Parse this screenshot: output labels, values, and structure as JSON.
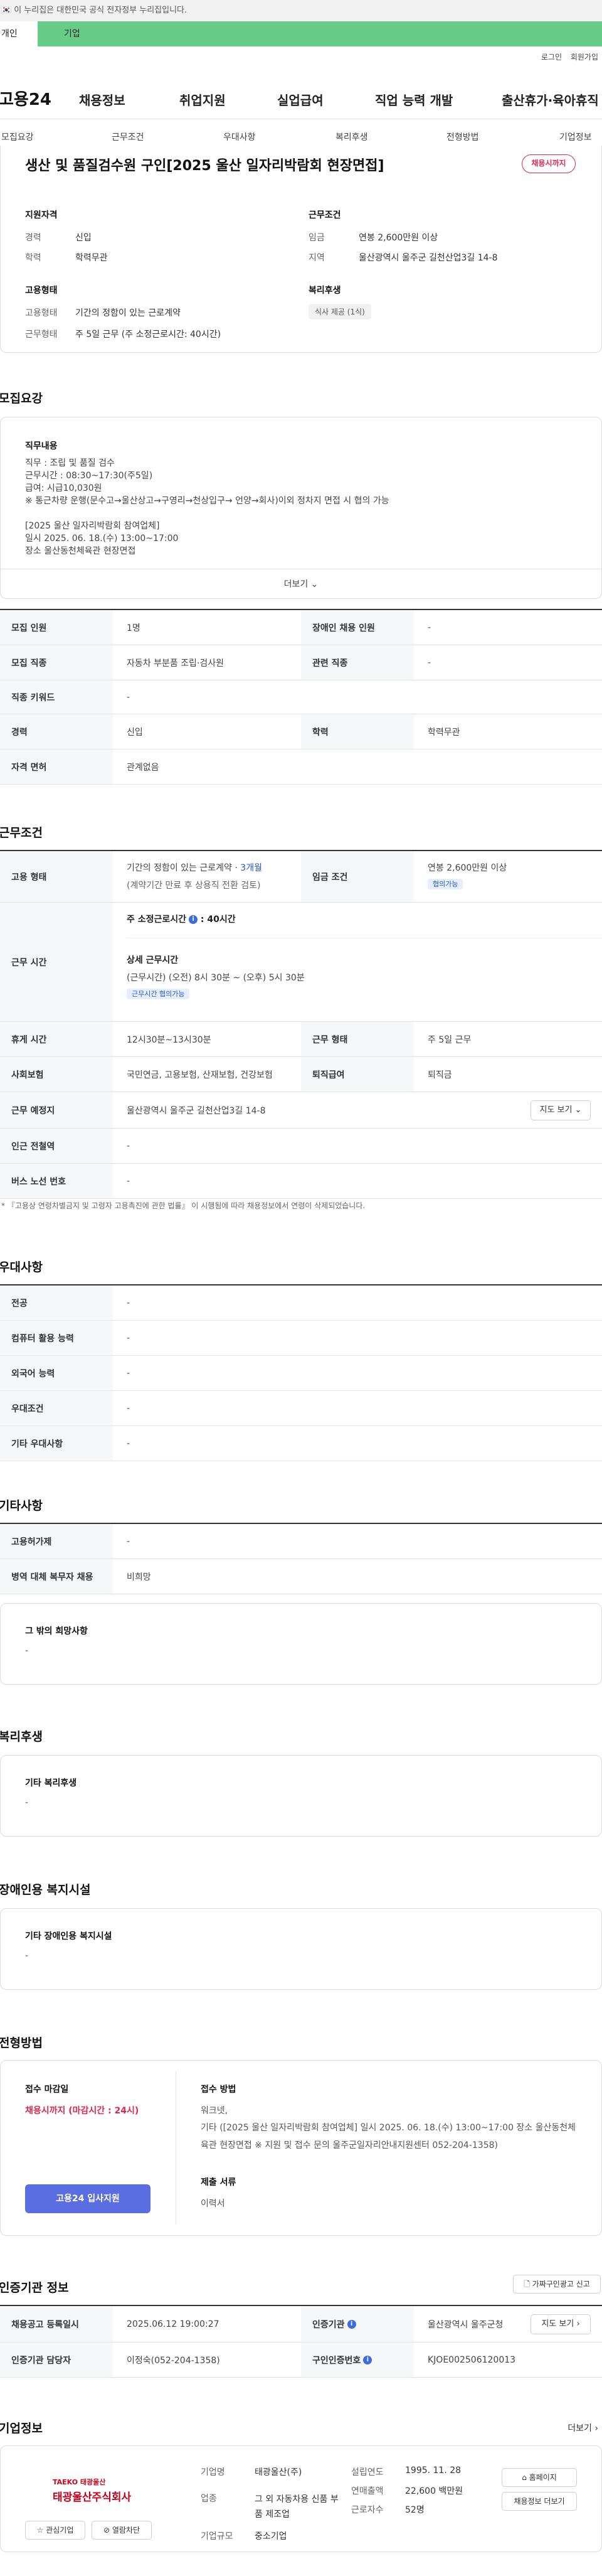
{
  "gov_banner": {
    "flag": "🇰🇷",
    "text": "이 누리집은 대한민국 공식 전자정부 누리집입니다."
  },
  "audience_tabs": {
    "personal": "개인",
    "corporate": "기업"
  },
  "util_links": {
    "login": "로그인",
    "signup": "회원가입"
  },
  "site": {
    "logo": "고용24"
  },
  "gnb": [
    "채용정보",
    "취업지원",
    "실업급여",
    "직업 능력 개발",
    "출산휴가·육아휴직"
  ],
  "subnav": [
    "모집요강",
    "근무조건",
    "우대사항",
    "복리후생",
    "전형방법",
    "기업정보"
  ],
  "job": {
    "title": "생산 및 품질검수원 구인[2025 울산 일자리박람회 현장면접]",
    "deadline_badge": "채용시까지"
  },
  "summary": {
    "qual_title": "지원자격",
    "career_label": "경력",
    "career_value": "신입",
    "edu_label": "학력",
    "edu_value": "학력무관",
    "cond_title": "근무조건",
    "wage_label": "임금",
    "wage_value": "연봉 2,600만원 이상",
    "area_label": "지역",
    "area_value": "울산광역시 울주군 길천산업3길 14-8",
    "emp_title": "고용형태",
    "emp_type_label": "고용형태",
    "emp_type_value": "기간의 정함이 있는 근로계약",
    "work_type_label": "근무형태",
    "work_type_value": "주 5일 근무 (주 소정근로시간: 40시간)",
    "welfare_title": "복리후생",
    "welfare_chip": "식사 제공 (1식)"
  },
  "recruit": {
    "section_title": "모집요강",
    "duty_label": "직무내용",
    "duty_lines": [
      "직무 : 조립 및 품질 검수",
      "근무시간 : 08:30~17:30(주5일)",
      "급여: 시급10,030원",
      "※ 통근차량 운행(문수고→울산상고→구영리→천상입구→ 언양→회사)이외 정차지 면접 시 협의 가능",
      "",
      "[2025 울산 일자리박람회 참여업체]",
      "일시 2025. 06. 18.(수) 13:00~17:00",
      "장소 울산동천체육관 현장면접"
    ],
    "more_label": "더보기",
    "table": [
      {
        "k1": "모집 인원",
        "v1": "1명",
        "k2": "장애인 채용 인원",
        "v2": "-"
      },
      {
        "k1": "모집 직종",
        "v1": "자동차 부분품 조립·검사원",
        "k2": "관련 직종",
        "v2": "-"
      },
      {
        "k1": "직종 키워드",
        "v1": "-"
      },
      {
        "k1": "경력",
        "v1": "신입",
        "k2": "학력",
        "v2": "학력무관"
      },
      {
        "k1": "자격 면허",
        "v1": "관계없음"
      }
    ]
  },
  "conditions": {
    "section_title": "근무조건",
    "emp_label": "고용 형태",
    "emp_value": "기간의 정함이 있는 근로계약",
    "emp_period": "3개월",
    "emp_note": "(계약기간 만료 후 상용직 전환 검토)",
    "wage_label": "임금 조건",
    "wage_value": "연봉 2,600만원 이상",
    "wage_chip": "협의가능",
    "hours_label": "근무 시간",
    "hours_week": "주 소정근로시간",
    "hours_week_value": "40시간",
    "hours_detail_title": "상세 근무시간",
    "hours_detail": "(근무시간) (오전) 8시 30분 ~ (오후) 5시 30분",
    "hours_chip": "근무시간 협의가능",
    "break_label": "휴게 시간",
    "break_value": "12시30분~13시30분",
    "form_label": "근무 형태",
    "form_value": "주 5일 근무",
    "insur_label": "사회보험",
    "insur_value": "국민연금, 고용보험, 산재보험, 건강보험",
    "sever_label": "퇴직급여",
    "sever_value": "퇴직금",
    "place_label": "근무 예정지",
    "place_value": "울산광역시 울주군 길천산업3길 14-8",
    "map_btn": "지도 보기",
    "subway_label": "인근 전철역",
    "subway_value": "-",
    "bus_label": "버스 노선 번호",
    "bus_value": "-",
    "footnote": "* 『고용상 연령차별금지 및 고령자 고용촉진에 관한 법률』 이 시행됨에 따라 채용정보에서 연령이 삭제되었습니다."
  },
  "preference": {
    "section_title": "우대사항",
    "rows": [
      {
        "k": "전공",
        "v": "-"
      },
      {
        "k": "컴퓨터 활용 능력",
        "v": "-"
      },
      {
        "k": "외국어 능력",
        "v": "-"
      },
      {
        "k": "우대조건",
        "v": "-"
      },
      {
        "k": "기타 우대사항",
        "v": "-"
      }
    ]
  },
  "etc": {
    "section_title": "기타사항",
    "rows": [
      {
        "k": "고용허가제",
        "v": "-"
      },
      {
        "k": "병역 대체 복무자 채용",
        "v": "비희망"
      }
    ],
    "box_label": "그 밖의 희망사항",
    "box_value": "-"
  },
  "welfare": {
    "section_title": "복리후생",
    "box_label": "기타 복리후생",
    "box_value": "-"
  },
  "disability": {
    "section_title": "장애인용 복지시설",
    "box_label": "기타 장애인용 복지시설",
    "box_value": "-"
  },
  "selection": {
    "section_title": "전형방법",
    "deadline_label": "접수 마감일",
    "deadline_value": "채용시까지 (마감시간 : 24시)",
    "method_label": "접수 방법",
    "method_value": "워크넷,",
    "method_detail": "기타 ([2025 울산 일자리박람회 참여업체] 일시 2025. 06. 18.(수) 13:00~17:00 장소 울산동천체육관 현장면접 ※ 지원 및 접수 문의 울주군일자리안내지원센터 052-204-1358)",
    "docs_label": "제출 서류",
    "docs_value": "이력서",
    "apply_btn": "고용24 입사지원"
  },
  "cert": {
    "section_title": "인증기관 정보",
    "copy_btn": "가짜구인광고 신고",
    "reg_label": "채용공고 등록일시",
    "reg_value": "2025.06.12 19:00:27",
    "agency_label": "인증기관",
    "agency_value": "울산광역시 울주군청",
    "map_btn": "지도 보기",
    "manager_label": "인증기관 담당자",
    "manager_value": "이정숙(052-204-1358)",
    "id_label": "구인인증번호",
    "id_value": "KJOE002506120013"
  },
  "company": {
    "section_title": "기업정보",
    "more": "더보기",
    "logo_top": "TAEKO 태광울산",
    "logo_name": "태광울산주식회사",
    "interest_btn": "관심기업",
    "block_btn": "열람차단",
    "name_label": "기업명",
    "name_value": "태광울산(주)",
    "industry_label": "업종",
    "industry_value": "그 외 자동차용 신품 부품 제조업",
    "size_label": "기업규모",
    "size_value": "중소기업",
    "founded_label": "설립연도",
    "founded_value": "1995. 11. 28",
    "sales_label": "연매출액",
    "sales_value": "22,600 백만원",
    "staff_label": "근로자수",
    "staff_value": "52명",
    "homepage_btn": "홈페이지",
    "jobs_btn": "채용정보 더보기"
  }
}
